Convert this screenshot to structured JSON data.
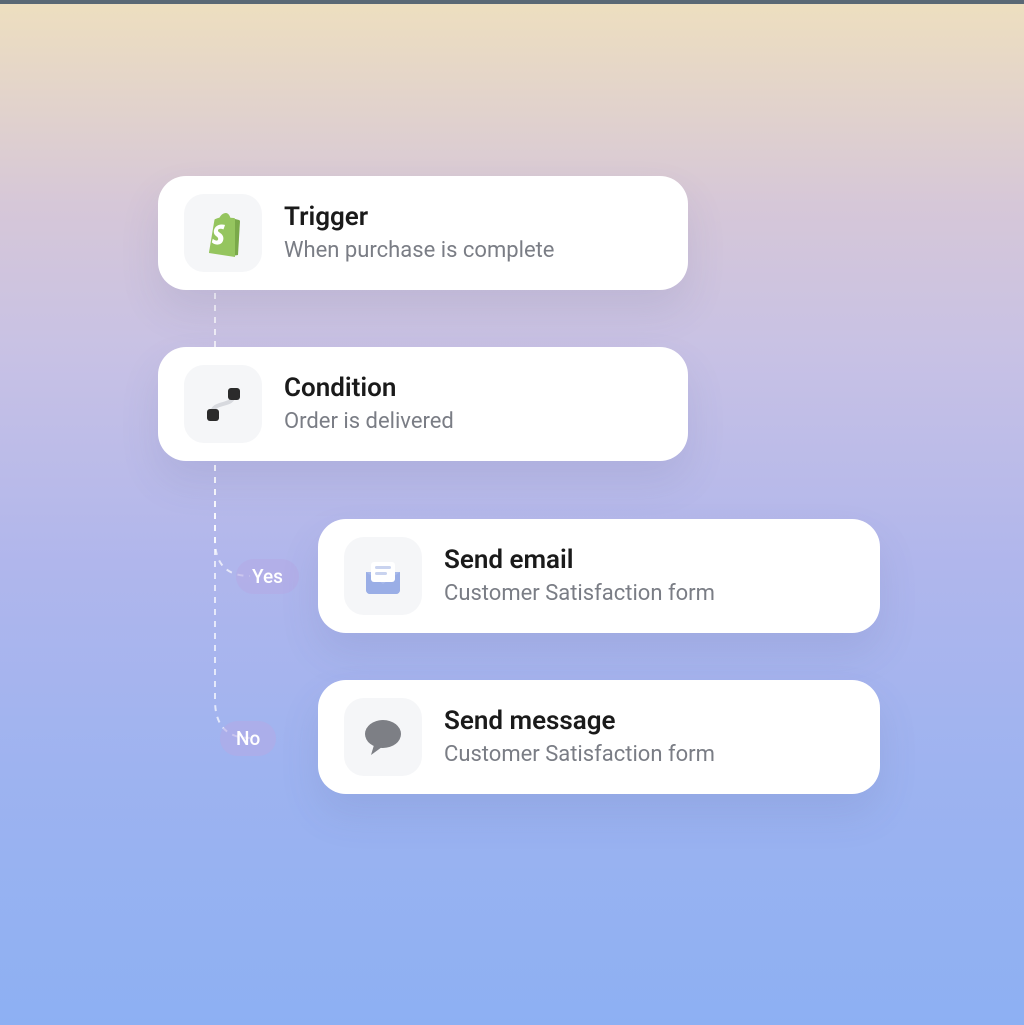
{
  "flow": {
    "trigger": {
      "title": "Trigger",
      "subtitle": "When purchase is complete",
      "icon": "shopify-icon"
    },
    "condition": {
      "title": "Condition",
      "subtitle": "Order is delivered",
      "icon": "branch-icon"
    },
    "branches": {
      "yes": {
        "label": "Yes",
        "action": {
          "title": "Send email",
          "subtitle": "Customer Satisfaction form",
          "icon": "email-icon"
        }
      },
      "no": {
        "label": "No",
        "action": {
          "title": "Send message",
          "subtitle": "Customer Satisfaction form",
          "icon": "chat-icon"
        }
      }
    }
  },
  "colors": {
    "icon_box_bg": "#f5f6f8",
    "subtitle": "#7a7d85",
    "shopify_green": "#95c55f",
    "email_blue": "#a7b9ea",
    "pill_bg": "rgba(180,170,230,0.55)"
  }
}
